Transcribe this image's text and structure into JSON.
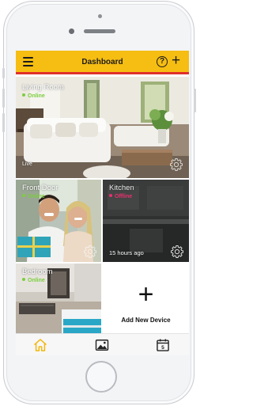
{
  "header": {
    "title": "Dashboard",
    "menu_icon": "hamburger-menu-icon",
    "help_icon": "question-mark-icon",
    "help_glyph": "?",
    "add_icon": "plus-icon",
    "add_glyph": "+"
  },
  "devices": [
    {
      "name": "Living Room",
      "status": "Online",
      "footer": "Live",
      "status_color": "#7ccd3f"
    },
    {
      "name": "Front Door",
      "status": "Online",
      "footer": "",
      "status_color": "#7ccd3f"
    },
    {
      "name": "Kitchen",
      "status": "Offline",
      "footer": "15 hours ago",
      "status_color": "#e8306e"
    },
    {
      "name": "Bedroom",
      "status": "Online",
      "footer": "",
      "status_color": "#7ccd3f"
    }
  ],
  "add_device": {
    "label": "Add New Device",
    "glyph": "+"
  },
  "tabbar": {
    "tabs": [
      {
        "icon": "home-icon",
        "active": true
      },
      {
        "icon": "gallery-icon",
        "active": false
      },
      {
        "icon": "calendar-icon",
        "label": "5",
        "active": false
      }
    ]
  },
  "colors": {
    "accent": "#f6bd12",
    "header_rule": "#e0302b",
    "online": "#7ccd3f",
    "offline": "#e8306e",
    "active_tab": "#f2b90f"
  }
}
